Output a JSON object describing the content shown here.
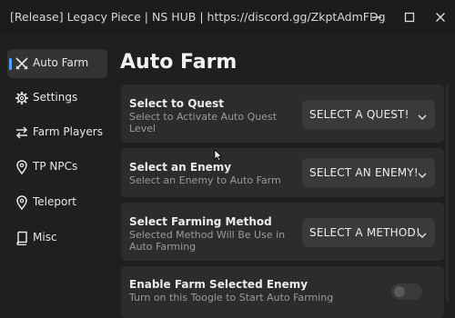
{
  "window": {
    "title": "[Release] Legacy Piece | NS HUB | https://discord.gg/ZkptAdmFDg"
  },
  "sidebar": {
    "items": [
      {
        "label": "Auto Farm",
        "icon": "crossed-swords-icon",
        "active": true
      },
      {
        "label": "Settings",
        "icon": "gear-icon"
      },
      {
        "label": "Farm Players",
        "icon": "swap-arrows-icon"
      },
      {
        "label": "TP NPCs",
        "icon": "map-pin-icon"
      },
      {
        "label": "Teleport",
        "icon": "map-pin-icon"
      },
      {
        "label": "Misc",
        "icon": "book-icon"
      }
    ],
    "accent_color": "#4fa3ff"
  },
  "main": {
    "title": "Auto Farm",
    "cards": [
      {
        "title": "Select to Quest",
        "description": "Select to Activate Auto Quest Level",
        "control": "dropdown",
        "value": "SELECT A QUEST!"
      },
      {
        "title": "Select an Enemy",
        "description": "Select an Enemy to Auto Farm",
        "control": "dropdown",
        "value": "SELECT AN ENEMY!"
      },
      {
        "title": "Select Farming Method",
        "description": "Selected Method Will Be Use in Auto Farming",
        "control": "dropdown",
        "value": "SELECT A METHOD!"
      },
      {
        "title": "Enable Farm Selected Enemy",
        "description": "Turn on this Toogle to Start Auto Farming",
        "control": "toggle",
        "on": false
      }
    ]
  }
}
